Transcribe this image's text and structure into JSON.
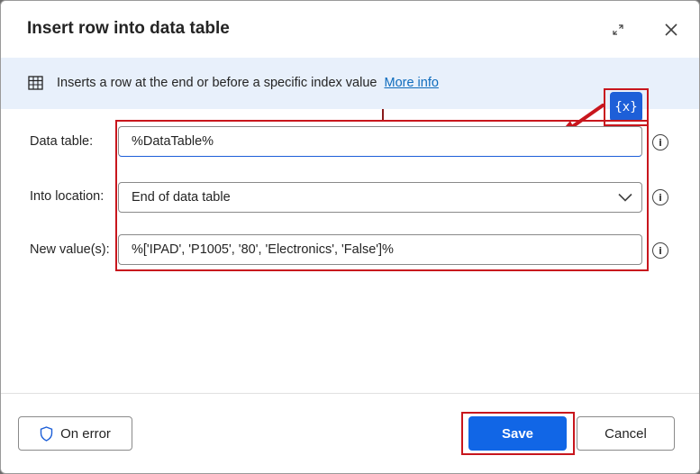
{
  "dialog": {
    "title": "Insert row into data table",
    "expand_icon": "expand-icon",
    "close_icon": "close-icon"
  },
  "info_bar": {
    "icon": "table-icon",
    "text": "Inserts a row at the end or before a specific index value",
    "link": "More info"
  },
  "variables_button": {
    "label": "{x}"
  },
  "fields": {
    "data_table": {
      "label": "Data table:",
      "value": "%DataTable%"
    },
    "into_location": {
      "label": "Into location:",
      "value": "End of data table"
    },
    "new_values": {
      "label": "New value(s):",
      "value": "%['IPAD', 'P1005', '80', 'Electronics', 'False']%"
    },
    "info_glyph": "i"
  },
  "footer": {
    "on_error": "On error",
    "save": "Save",
    "cancel": "Cancel"
  },
  "colors": {
    "accent": "#1166e6",
    "highlight": "#c8161d",
    "info_bar_bg": "#e8f0fb"
  }
}
